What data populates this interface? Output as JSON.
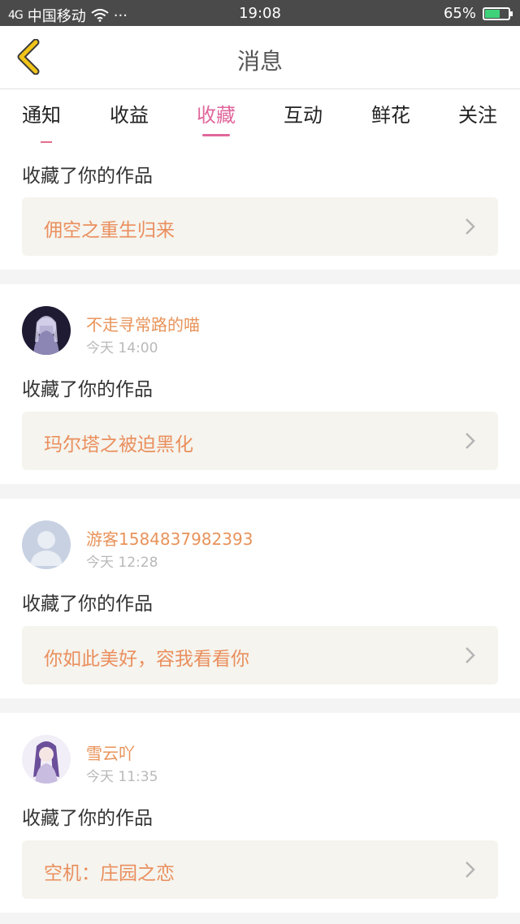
{
  "status_bar": {
    "signal": "4G",
    "carrier": "中国移动",
    "more": "···",
    "time": "19:08",
    "battery_pct": "65%",
    "battery_level": 0.65
  },
  "header": {
    "title": "消息"
  },
  "tabs": [
    {
      "label": "通知"
    },
    {
      "label": "收益"
    },
    {
      "label": "收藏",
      "active": true
    },
    {
      "label": "互动"
    },
    {
      "label": "鲜花"
    },
    {
      "label": "关注"
    }
  ],
  "feed": [
    {
      "action": "收藏了你的作品",
      "work": "佣空之重生归来"
    },
    {
      "name": "不走寻常路的喵",
      "time": "今天 14:00",
      "action": "收藏了你的作品",
      "work": "玛尔塔之被迫黑化",
      "avatar": "anime-dark"
    },
    {
      "name": "游客1584837982393",
      "time": "今天 12:28",
      "action": "收藏了你的作品",
      "work": "你如此美好，容我看看你",
      "avatar": "default"
    },
    {
      "name": "雪云吖",
      "time": "今天 11:35",
      "action": "收藏了你的作品",
      "work": "空机：庄园之恋",
      "avatar": "anime-light"
    }
  ],
  "colors": {
    "accent": "#e0679c",
    "name": "#e8935a",
    "work_title": "#ea8f5e",
    "back_icon": "#f0c419"
  }
}
